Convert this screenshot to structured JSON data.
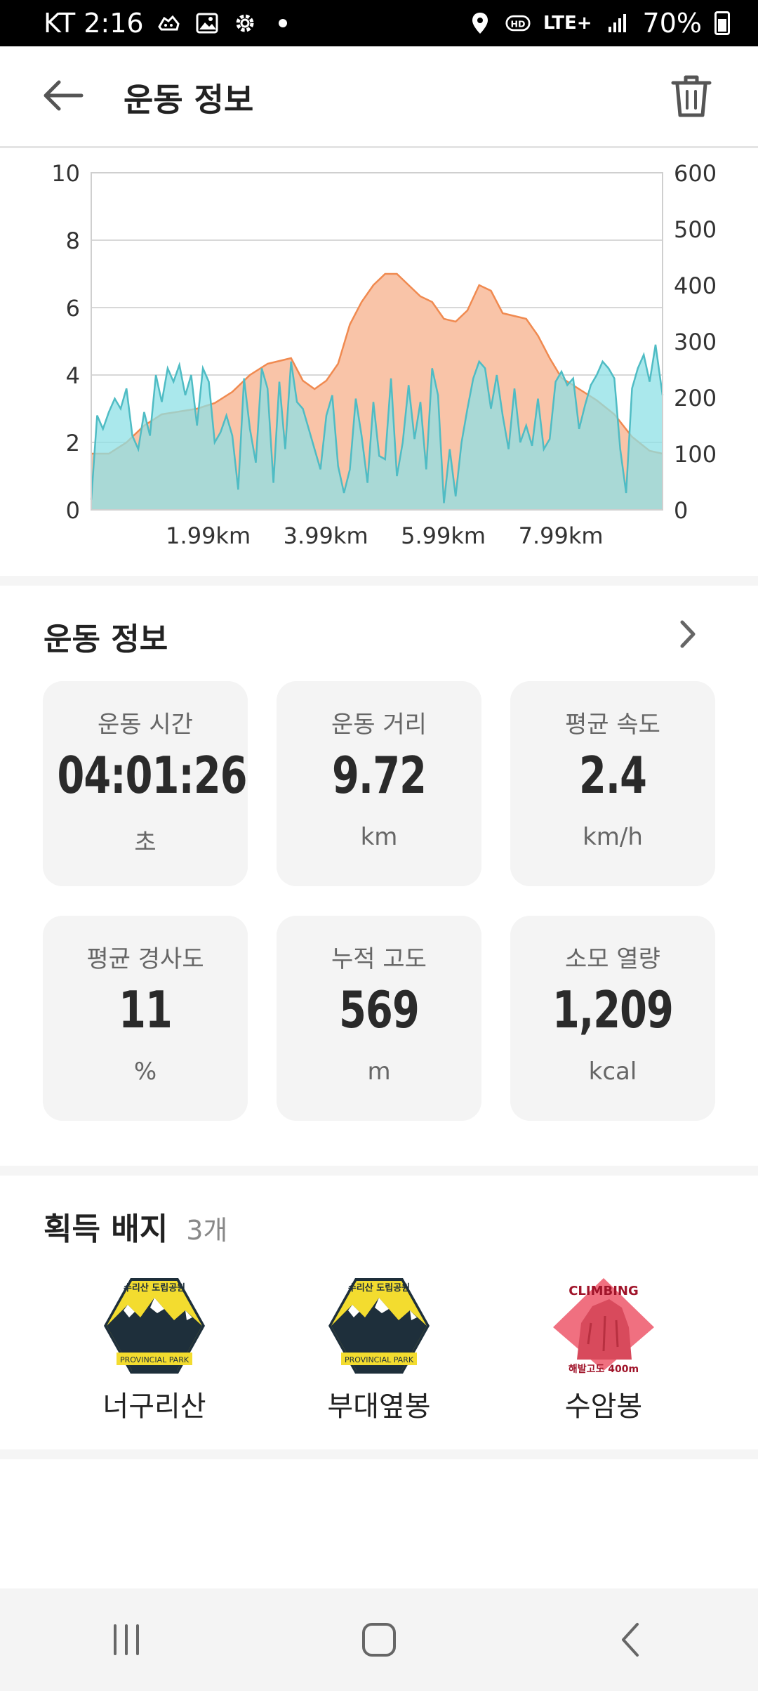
{
  "status_bar": {
    "carrier_time": "KT 2:16",
    "network": "LTE+",
    "battery": "70%",
    "icons": [
      "sneaker-icon",
      "gallery-icon",
      "settings-icon",
      "dot-icon",
      "location-icon",
      "hd-icon",
      "signal-icon",
      "battery-icon"
    ]
  },
  "app_bar": {
    "title": "운동 정보",
    "back_icon": "arrow-left-icon",
    "delete_icon": "trash-icon"
  },
  "chart_data": {
    "type": "area",
    "x_ticks": [
      "1.99km",
      "3.99km",
      "5.99km",
      "7.99km"
    ],
    "x_tick_values": [
      1.99,
      3.99,
      5.99,
      7.99
    ],
    "xlim": [
      0,
      9.72
    ],
    "left_axis": {
      "ticks": [
        "0",
        "2",
        "4",
        "6",
        "8",
        "10"
      ],
      "ylim": [
        0,
        10
      ]
    },
    "right_axis": {
      "ticks": [
        "0",
        "100",
        "200",
        "300",
        "400",
        "500",
        "600"
      ],
      "ylim": [
        0,
        600
      ]
    },
    "grid": "horizontal",
    "series": [
      {
        "axis": "right",
        "color": "#f08a50",
        "fill": "#f9c4a8",
        "x": [
          0,
          0.3,
          0.6,
          0.9,
          1.2,
          1.5,
          1.8,
          2.1,
          2.4,
          2.7,
          3.0,
          3.2,
          3.4,
          3.6,
          3.8,
          4.0,
          4.2,
          4.4,
          4.6,
          4.8,
          5.0,
          5.2,
          5.4,
          5.6,
          5.8,
          6.0,
          6.2,
          6.4,
          6.6,
          6.8,
          7.0,
          7.2,
          7.4,
          7.6,
          7.8,
          8.0,
          8.3,
          8.6,
          8.9,
          9.2,
          9.5,
          9.72
        ],
        "y": [
          100,
          100,
          120,
          150,
          170,
          175,
          180,
          190,
          210,
          240,
          260,
          265,
          270,
          230,
          215,
          230,
          260,
          330,
          370,
          400,
          420,
          420,
          400,
          380,
          370,
          340,
          335,
          355,
          400,
          390,
          350,
          345,
          340,
          310,
          270,
          235,
          215,
          195,
          170,
          130,
          105,
          100
        ]
      },
      {
        "axis": "left",
        "color": "#4fbcc4",
        "fill": "#8ee0e6",
        "x": [
          0,
          0.1,
          0.2,
          0.3,
          0.4,
          0.5,
          0.6,
          0.7,
          0.8,
          0.9,
          1.0,
          1.1,
          1.2,
          1.3,
          1.4,
          1.5,
          1.6,
          1.7,
          1.8,
          1.9,
          2.0,
          2.1,
          2.2,
          2.3,
          2.4,
          2.5,
          2.6,
          2.7,
          2.8,
          2.9,
          3.0,
          3.1,
          3.2,
          3.3,
          3.4,
          3.5,
          3.6,
          3.7,
          3.8,
          3.9,
          4.0,
          4.1,
          4.2,
          4.3,
          4.4,
          4.5,
          4.6,
          4.7,
          4.8,
          4.9,
          5.0,
          5.1,
          5.2,
          5.3,
          5.4,
          5.5,
          5.6,
          5.7,
          5.8,
          5.9,
          6.0,
          6.1,
          6.2,
          6.3,
          6.4,
          6.5,
          6.6,
          6.7,
          6.8,
          6.9,
          7.0,
          7.1,
          7.2,
          7.3,
          7.4,
          7.5,
          7.6,
          7.7,
          7.8,
          7.9,
          8.0,
          8.1,
          8.2,
          8.3,
          8.4,
          8.5,
          8.6,
          8.7,
          8.8,
          8.9,
          9.0,
          9.1,
          9.2,
          9.3,
          9.4,
          9.5,
          9.6,
          9.72
        ],
        "y": [
          0.3,
          2.8,
          2.4,
          2.9,
          3.3,
          3.0,
          3.6,
          2.2,
          1.8,
          2.9,
          2.2,
          4.0,
          3.2,
          4.2,
          3.8,
          4.3,
          3.4,
          4.0,
          2.5,
          4.2,
          3.8,
          2.0,
          2.3,
          2.8,
          2.2,
          0.6,
          3.9,
          2.4,
          1.4,
          4.2,
          3.6,
          0.8,
          3.8,
          1.8,
          4.4,
          3.2,
          3.0,
          2.4,
          1.8,
          1.2,
          2.8,
          3.4,
          1.3,
          0.5,
          1.2,
          3.3,
          2.2,
          0.8,
          3.2,
          1.6,
          1.5,
          3.9,
          1.0,
          2.0,
          3.7,
          2.1,
          3.2,
          1.2,
          4.2,
          3.4,
          0.2,
          1.8,
          0.4,
          2.0,
          3.0,
          3.9,
          4.4,
          4.2,
          3.0,
          4.0,
          2.8,
          1.8,
          3.6,
          2.0,
          2.5,
          1.9,
          3.3,
          1.8,
          2.1,
          3.8,
          4.1,
          3.7,
          3.9,
          2.4,
          3.1,
          3.7,
          4.0,
          4.4,
          4.2,
          3.9,
          1.8,
          0.5,
          3.6,
          4.2,
          4.6,
          3.8,
          4.9,
          3.4
        ]
      }
    ]
  },
  "exercise_info": {
    "title": "운동 정보",
    "chevron_icon": "chevron-right-icon",
    "cards": [
      {
        "label": "운동 시간",
        "value": "04:01:26",
        "unit": "초"
      },
      {
        "label": "운동 거리",
        "value": "9.72",
        "unit": "km"
      },
      {
        "label": "평균 속도",
        "value": "2.4",
        "unit": "km/h"
      },
      {
        "label": "평균 경사도",
        "value": "11",
        "unit": "%"
      },
      {
        "label": "누적 고도",
        "value": "569",
        "unit": "m"
      },
      {
        "label": "소모 열량",
        "value": "1,209",
        "unit": "kcal"
      }
    ]
  },
  "badges": {
    "title": "획득 배지",
    "count": "3개",
    "items": [
      {
        "name": "너구리산",
        "icon": "provincial-park-badge-icon",
        "arc_text": "수리산 도립공원",
        "sub_text": "PROVINCIAL PARK"
      },
      {
        "name": "부대옆봉",
        "icon": "provincial-park-badge-icon",
        "arc_text": "수리산 도립공원",
        "sub_text": "PROVINCIAL PARK"
      },
      {
        "name": "수암봉",
        "icon": "climbing-badge-icon",
        "arc_text": "CLIMBING",
        "sub_text": "해발고도 400m"
      }
    ]
  },
  "nav_bar": {
    "icons": [
      "recents-icon",
      "home-icon",
      "back-icon"
    ]
  }
}
